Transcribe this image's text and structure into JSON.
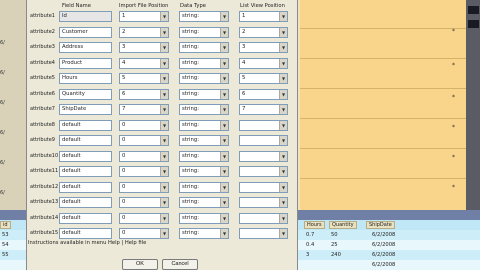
{
  "dialog": {
    "headers": {
      "field_name": "Field Name",
      "import_position": "Import File Position",
      "data_type": "Data Type",
      "list_view_position": "List View Position"
    },
    "rows": [
      {
        "attr": "attribute1",
        "field": "Id",
        "import": "1",
        "type": "string:",
        "list": "1"
      },
      {
        "attr": "attribute2",
        "field": "Customer",
        "import": "2",
        "type": "string:",
        "list": "2"
      },
      {
        "attr": "attribute3",
        "field": "Address",
        "import": "3",
        "type": "string:",
        "list": "3"
      },
      {
        "attr": "attribute4",
        "field": "Product",
        "import": "4",
        "type": "string:",
        "list": "4"
      },
      {
        "attr": "attribute5",
        "field": "Hours",
        "import": "5",
        "type": "string:",
        "list": "5"
      },
      {
        "attr": "attribute6",
        "field": "Quantity",
        "import": "6",
        "type": "string:",
        "list": "6"
      },
      {
        "attr": "attribute7",
        "field": "ShipDate",
        "import": "7",
        "type": "string:",
        "list": "7"
      },
      {
        "attr": "attribute8",
        "field": "default",
        "import": "0",
        "type": "string:",
        "list": ""
      },
      {
        "attr": "attribute9",
        "field": "default",
        "import": "0",
        "type": "string:",
        "list": ""
      },
      {
        "attr": "attribute10",
        "field": "default",
        "import": "0",
        "type": "string:",
        "list": ""
      },
      {
        "attr": "attribute11",
        "field": "default",
        "import": "0",
        "type": "string:",
        "list": ""
      },
      {
        "attr": "attribute12",
        "field": "default",
        "import": "0",
        "type": "string:",
        "list": ""
      },
      {
        "attr": "attribute13",
        "field": "default",
        "import": "0",
        "type": "string:",
        "list": ""
      },
      {
        "attr": "attribute14",
        "field": "default",
        "import": "0",
        "type": "string:",
        "list": ""
      },
      {
        "attr": "attribute15",
        "field": "default",
        "import": "0",
        "type": "string:",
        "list": ""
      }
    ],
    "instructions": "Instructions available in menu Help | Help file",
    "ok_label": "OK",
    "cancel_label": "Cancel"
  },
  "background": {
    "left_rows": [
      "6/",
      "6/",
      "6/",
      "6/",
      "6/",
      "6/"
    ],
    "bottom_headers": {
      "id": "id",
      "hours": "Hours",
      "quantity": "Quantity",
      "shipdate": "ShipDate"
    },
    "bottom_rows": [
      {
        "id": "53",
        "hours": "0.7",
        "quantity": "50",
        "shipdate": "6/2/2008"
      },
      {
        "id": "54",
        "hours": "0.4",
        "quantity": "25",
        "shipdate": "6/2/2008"
      },
      {
        "id": "55",
        "hours": "3",
        "quantity": "240",
        "shipdate": "6/2/2008"
      },
      {
        "id": "",
        "hours": "",
        "quantity": "",
        "shipdate": "6/2/2008"
      }
    ]
  }
}
